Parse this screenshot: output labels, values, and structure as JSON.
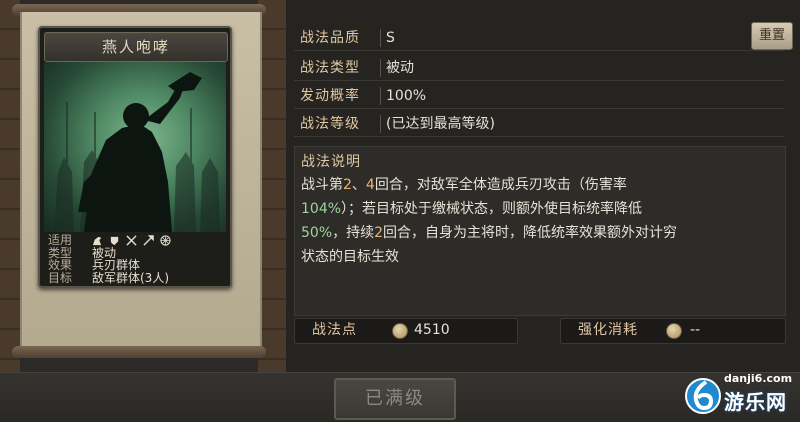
{
  "card": {
    "title": "燕人咆哮",
    "info": [
      {
        "key": "适用",
        "value": ""
      },
      {
        "key": "类型",
        "value": "被动"
      },
      {
        "key": "效果",
        "value": "兵刃群体"
      },
      {
        "key": "目标",
        "value": "敌军群体(3人)"
      }
    ],
    "applicable_icons": [
      "cavalry-icon",
      "shield-icon",
      "crossed-bow-icon",
      "spear-icon",
      "wheel-icon"
    ]
  },
  "stats": [
    {
      "label": "战法品质",
      "value": "S"
    },
    {
      "label": "战法类型",
      "value": "被动"
    },
    {
      "label": "发动概率",
      "value": "100%"
    },
    {
      "label": "战法等级",
      "value": "(已达到最高等级)"
    }
  ],
  "reset_button": "重置",
  "description": {
    "title": "战法说明",
    "line1_a": "战斗第",
    "line1_n1": "2",
    "line1_b": "、",
    "line1_n2": "4",
    "line1_c": "回合，对敌军全体造成兵刃攻击（伤害率",
    "line2_pct": "104%",
    "line2_rest": "）；若目标处于缴械状态，则额外使目标统率降低",
    "line3_pct": "50%",
    "line3_a": "，持续",
    "line3_n": "2",
    "line3_rest": "回合，自身为主将时，降低统率效果额外对计穷",
    "line4": "状态的目标生效"
  },
  "points": {
    "label": "战法点",
    "value": "4510"
  },
  "upgrade_cost": {
    "label": "强化消耗",
    "value": "--"
  },
  "max_button": "已满级",
  "watermark": {
    "url": "danji6.com",
    "name": "游乐网"
  },
  "colors": {
    "label": "#e0c7a3",
    "highlight_green": "#9fd39a",
    "highlight_orange": "#e8b872"
  }
}
